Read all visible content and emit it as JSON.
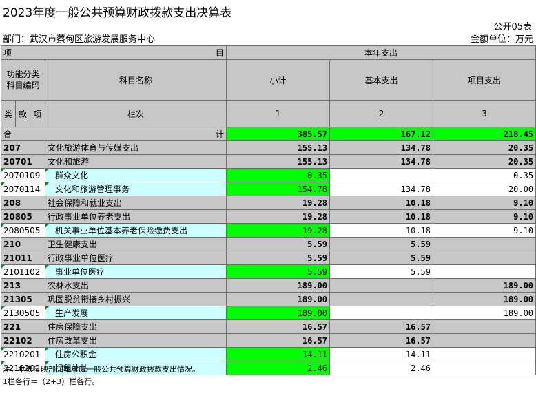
{
  "title": "2023年度一般公共预算财政拨款支出决算表",
  "form_no": "公开05表",
  "department": "部门：武汉市蔡甸区旅游发展服务中心",
  "unit": "金额单位：万元",
  "header": {
    "item": "项",
    "mu": "目",
    "current_year": "本年支出",
    "func_code": "功能分类\n科目编码",
    "subject_name": "科目名称",
    "subtotal": "小计",
    "basic": "基本支出",
    "project": "项目支出",
    "col_label": "栏次",
    "col1": "1",
    "col2": "2",
    "col3": "3",
    "lei": "类",
    "kuan": "款",
    "xiang": "项"
  },
  "total": {
    "he": "合",
    "ji": "计",
    "subtotal": "385.57",
    "basic": "167.12",
    "project": "218.45"
  },
  "rows": [
    {
      "code": "207",
      "name": "文化旅游体育与传媒支出",
      "subtotal": "155.13",
      "basic": "134.78",
      "project": "20.35"
    },
    {
      "code": "20701",
      "name": "文化和旅游",
      "subtotal": "155.13",
      "basic": "134.78",
      "project": "20.35"
    },
    {
      "code": "2070109",
      "name": "群众文化",
      "subtotal": "0.35",
      "basic": "",
      "project": "0.35"
    },
    {
      "code": "2070114",
      "name": "文化和旅游管理事务",
      "subtotal": "154.78",
      "basic": "134.78",
      "project": "20.00"
    },
    {
      "code": "208",
      "name": "社会保障和就业支出",
      "subtotal": "19.28",
      "basic": "10.18",
      "project": "9.10"
    },
    {
      "code": "20805",
      "name": "行政事业单位养老支出",
      "subtotal": "19.28",
      "basic": "10.18",
      "project": "9.10"
    },
    {
      "code": "2080505",
      "name": "机关事业单位基本养老保险缴费支出",
      "subtotal": "19.28",
      "basic": "10.18",
      "project": "9.10"
    },
    {
      "code": "210",
      "name": "卫生健康支出",
      "subtotal": "5.59",
      "basic": "5.59",
      "project": ""
    },
    {
      "code": "21011",
      "name": "行政事业单位医疗",
      "subtotal": "5.59",
      "basic": "5.59",
      "project": ""
    },
    {
      "code": "2101102",
      "name": "事业单位医疗",
      "subtotal": "5.59",
      "basic": "5.59",
      "project": ""
    },
    {
      "code": "213",
      "name": "农林水支出",
      "subtotal": "189.00",
      "basic": "",
      "project": "189.00"
    },
    {
      "code": "21305",
      "name": "巩固脱贫衔接乡村振兴",
      "subtotal": "189.00",
      "basic": "",
      "project": "189.00"
    },
    {
      "code": "2130505",
      "name": "生产发展",
      "subtotal": "189.00",
      "basic": "",
      "project": "189.00"
    },
    {
      "code": "221",
      "name": "住房保障支出",
      "subtotal": "16.57",
      "basic": "16.57",
      "project": ""
    },
    {
      "code": "22102",
      "name": "住房改革支出",
      "subtotal": "16.57",
      "basic": "16.57",
      "project": ""
    },
    {
      "code": "2210201",
      "name": "住房公积金",
      "subtotal": "14.11",
      "basic": "14.11",
      "project": ""
    },
    {
      "code": "2210202",
      "name": "提租补贴",
      "subtotal": "2.46",
      "basic": "2.46",
      "project": ""
    }
  ],
  "notes": {
    "note1": "注：本表反映部门本年度一般公共预算财政拨款支出情况。",
    "note2": "1栏各行＝（2+3）栏各行。"
  },
  "colors": {
    "header_gray": "#c7c7c7",
    "total_green": "#00ff00",
    "leaf_cyan": "#ccffff",
    "leaf_green": "#ccffcc"
  }
}
